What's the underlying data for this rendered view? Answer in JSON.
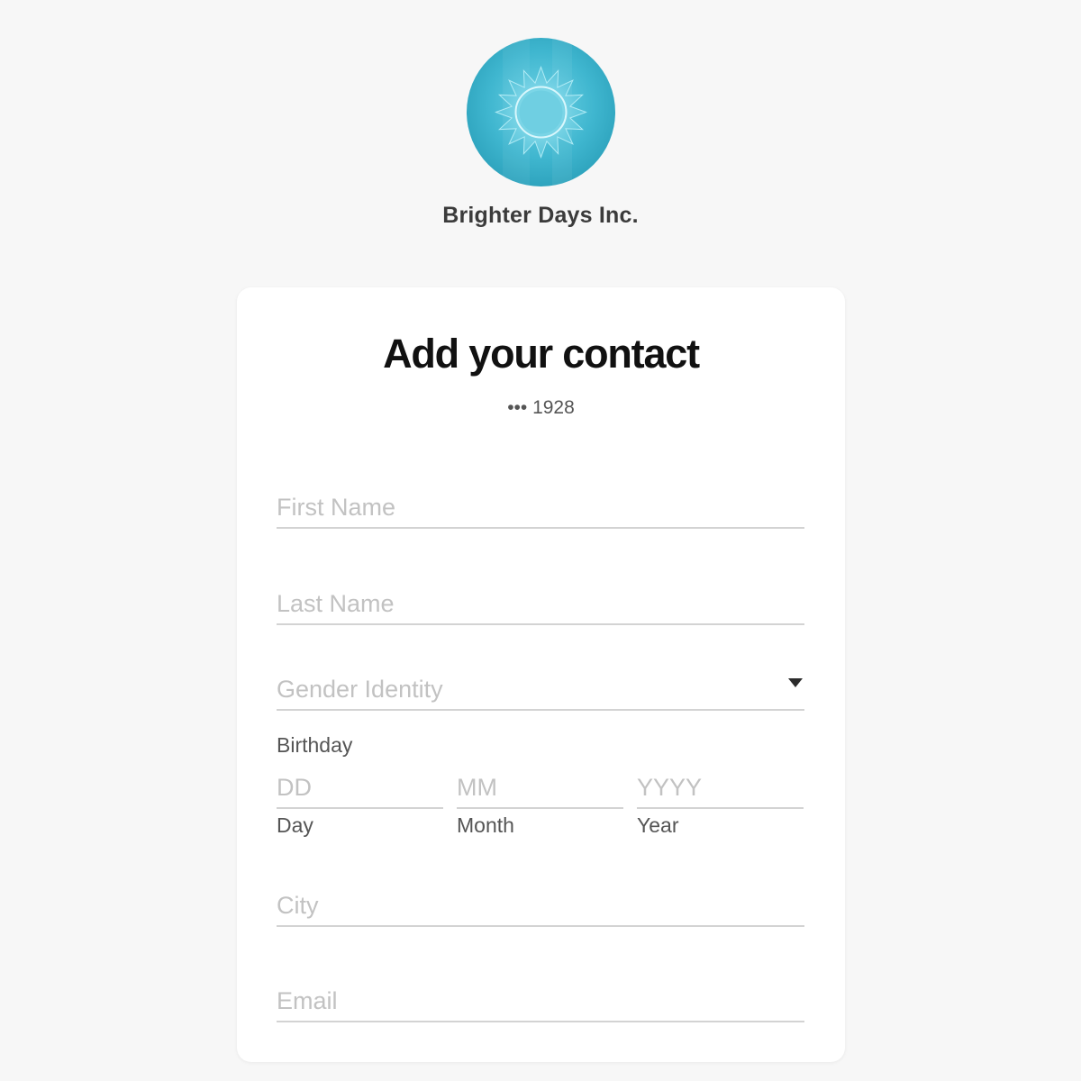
{
  "company": {
    "name": "Brighter Days Inc.",
    "logo_icon": "sun-logo-icon"
  },
  "form": {
    "title": "Add your contact",
    "masked_number": "••• 1928",
    "first_name_placeholder": "First Name",
    "last_name_placeholder": "Last Name",
    "gender_placeholder": "Gender Identity",
    "gender_icon": "caret-down-icon",
    "birthday": {
      "label": "Birthday",
      "day_placeholder": "DD",
      "month_placeholder": "MM",
      "year_placeholder": "YYYY",
      "day_label": "Day",
      "month_label": "Month",
      "year_label": "Year"
    },
    "city_placeholder": "City",
    "email_placeholder": "Email"
  },
  "colors": {
    "background": "#f7f7f7",
    "card": "#ffffff",
    "logo_teal": "#3fb6cf",
    "underline": "#d3d3d3",
    "placeholder": "#c2c2c2"
  }
}
